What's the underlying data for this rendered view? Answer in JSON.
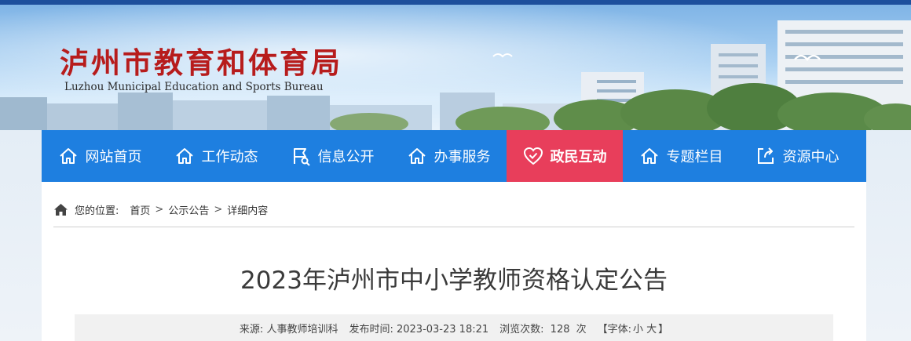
{
  "site": {
    "name_cn": "泸州市教育和体育局",
    "name_en": "Luzhou Municipal Education and Sports Bureau"
  },
  "nav": [
    {
      "label": "网站首页",
      "icon": "home-icon",
      "active": false
    },
    {
      "label": "工作动态",
      "icon": "home-icon",
      "active": false
    },
    {
      "label": "信息公开",
      "icon": "flag-search-icon",
      "active": false
    },
    {
      "label": "办事服务",
      "icon": "home-icon",
      "active": false
    },
    {
      "label": "政民互动",
      "icon": "heart-check-icon",
      "active": true
    },
    {
      "label": "专题栏目",
      "icon": "home-icon",
      "active": false
    },
    {
      "label": "资源中心",
      "icon": "share-icon",
      "active": false
    }
  ],
  "breadcrumb": {
    "prefix": "您的位置:",
    "items": [
      "首页",
      "公示公告",
      "详细内容"
    ],
    "separator": ">"
  },
  "article": {
    "title": "2023年泸州市中小学教师资格认定公告",
    "source_label": "来源:",
    "source": "人事教师培训科",
    "date_label": "发布时间:",
    "date": "2023-03-23 18:21",
    "views_label": "浏览次数:",
    "views": "128",
    "views_unit": "次",
    "font_open": "【字体:",
    "font_small": "小",
    "font_large": "大",
    "font_close": "】"
  },
  "colors": {
    "nav_bg": "#1e7fe0",
    "nav_active": "#e83e5b",
    "logo_red": "#b71c1c",
    "top_bar": "#1d4f9c"
  }
}
